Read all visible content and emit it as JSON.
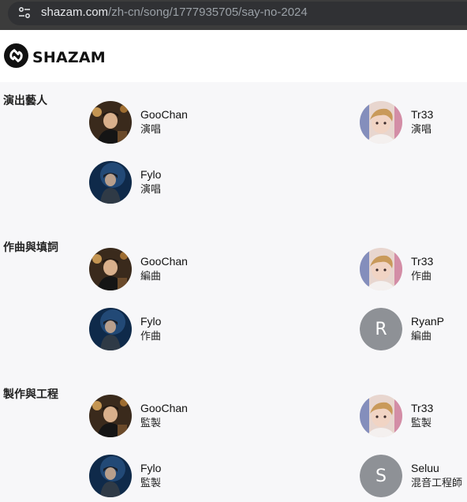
{
  "browser": {
    "url_host": "shazam.com",
    "url_path": "/zh-cn/song/1777935705/say-no-2024",
    "site_info_icon": "tune-icon"
  },
  "header": {
    "logo_text": "SHAZAM",
    "logo_icon": "shazam-logo-icon"
  },
  "sections": [
    {
      "title": "演出藝人",
      "credits": [
        {
          "name": "GooChan",
          "role": "演唱",
          "avatar": "photo-goochan"
        },
        {
          "name": "Tr33",
          "role": "演唱",
          "avatar": "photo-tr33"
        },
        {
          "name": "Fylo",
          "role": "演唱",
          "avatar": "photo-fylo"
        }
      ]
    },
    {
      "title": "作曲與填詞",
      "credits": [
        {
          "name": "GooChan",
          "role": "編曲",
          "avatar": "photo-goochan"
        },
        {
          "name": "Tr33",
          "role": "作曲",
          "avatar": "photo-tr33"
        },
        {
          "name": "Fylo",
          "role": "作曲",
          "avatar": "photo-fylo"
        },
        {
          "name": "RyanP",
          "role": "編曲",
          "avatar_letter": "R"
        }
      ]
    },
    {
      "title": "製作與工程",
      "credits": [
        {
          "name": "GooChan",
          "role": "監製",
          "avatar": "photo-goochan"
        },
        {
          "name": "Tr33",
          "role": "監製",
          "avatar": "photo-tr33"
        },
        {
          "name": "Fylo",
          "role": "監製",
          "avatar": "photo-fylo"
        },
        {
          "name": "Seluu",
          "role": "混音工程師",
          "avatar_letter": "S"
        }
      ]
    }
  ],
  "colors": {
    "page_bg": "#f7f7f9",
    "letter_avatar_bg": "#8e9196",
    "url_bar_bg": "#3c3c3c"
  }
}
